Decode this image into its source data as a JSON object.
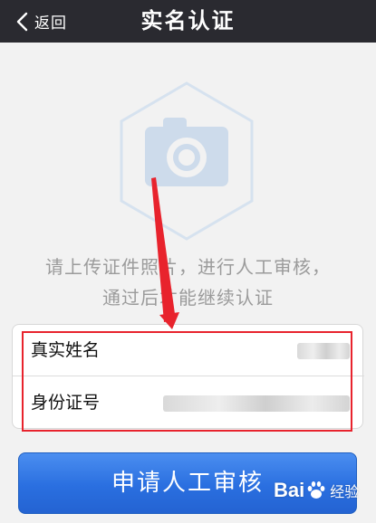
{
  "header": {
    "back_label": "返回",
    "title": "实名认证"
  },
  "photo_upload": {
    "icon": "camera-icon",
    "frame_shape": "hexagon-outline",
    "hint_line1": "请上传证件照片，进行人工审核，",
    "hint_line2": "通过后才能继续认证"
  },
  "form": {
    "name_label": "真实姓名",
    "name_value": "",
    "id_label": "身份证号",
    "id_value": ""
  },
  "submit": {
    "label": "申请人工审核"
  },
  "watermark": {
    "text": "Bai",
    "text2": "经验"
  },
  "colors": {
    "navbar_bg": "#2a2a30",
    "page_bg": "#f2f2f2",
    "hint_text": "#9b9b9b",
    "hexagon_stroke": "#d6e2ef",
    "camera_fill": "#cddbeb",
    "annotation_red": "#e8232d",
    "button_blue": "#2a6fe0"
  }
}
